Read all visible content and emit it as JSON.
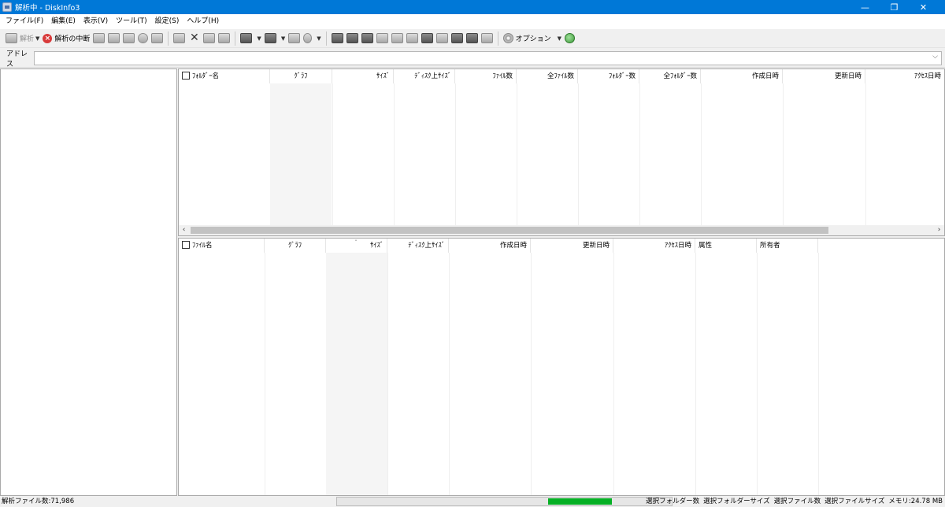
{
  "window": {
    "title": "解析中 - DiskInfo3",
    "minimize": "—",
    "restore": "❐",
    "close": "✕"
  },
  "menu": [
    "ファイル(F)",
    "編集(E)",
    "表示(V)",
    "ツール(T)",
    "設定(S)",
    "ヘルプ(H)"
  ],
  "toolbar": {
    "analyze_label": "解析",
    "stop_label": "解析の中断",
    "options_label": "オプション"
  },
  "address": {
    "label": "アドレス",
    "value": ""
  },
  "folder_table": {
    "headers": [
      "ﾌｫﾙﾀﾞｰ名",
      "ｸﾞﾗﾌ",
      "ｻｲｽﾞ",
      "ﾃﾞｨｽｸ上ｻｲｽﾞ",
      "ﾌｧｲﾙ数",
      "全ﾌｧｲﾙ数",
      "ﾌｫﾙﾀﾞｰ数",
      "全ﾌｫﾙﾀﾞｰ数",
      "作成日時",
      "更新日時",
      "ｱｸｾｽ日時"
    ],
    "rows": []
  },
  "file_table": {
    "headers": [
      "ﾌｧｲﾙ名",
      "ｸﾞﾗﾌ",
      "ｻｲｽﾞ",
      "ﾃﾞｨｽｸ上ｻｲｽﾞ",
      "作成日時",
      "更新日時",
      "ｱｸｾｽ日時",
      "属性",
      "所有者"
    ],
    "rows": []
  },
  "status": {
    "analyzed_files": "解析ファイル数:71,986",
    "progress": 0.19,
    "progress_color": "#06b025",
    "selected_folders": "選択フォルダー数",
    "selected_folder_size": "選択フォルダーサイズ",
    "selected_files": "選択ファイル数",
    "selected_file_size": "選択ファイルサイズ",
    "memory": "メモリ:24.78 MB"
  }
}
